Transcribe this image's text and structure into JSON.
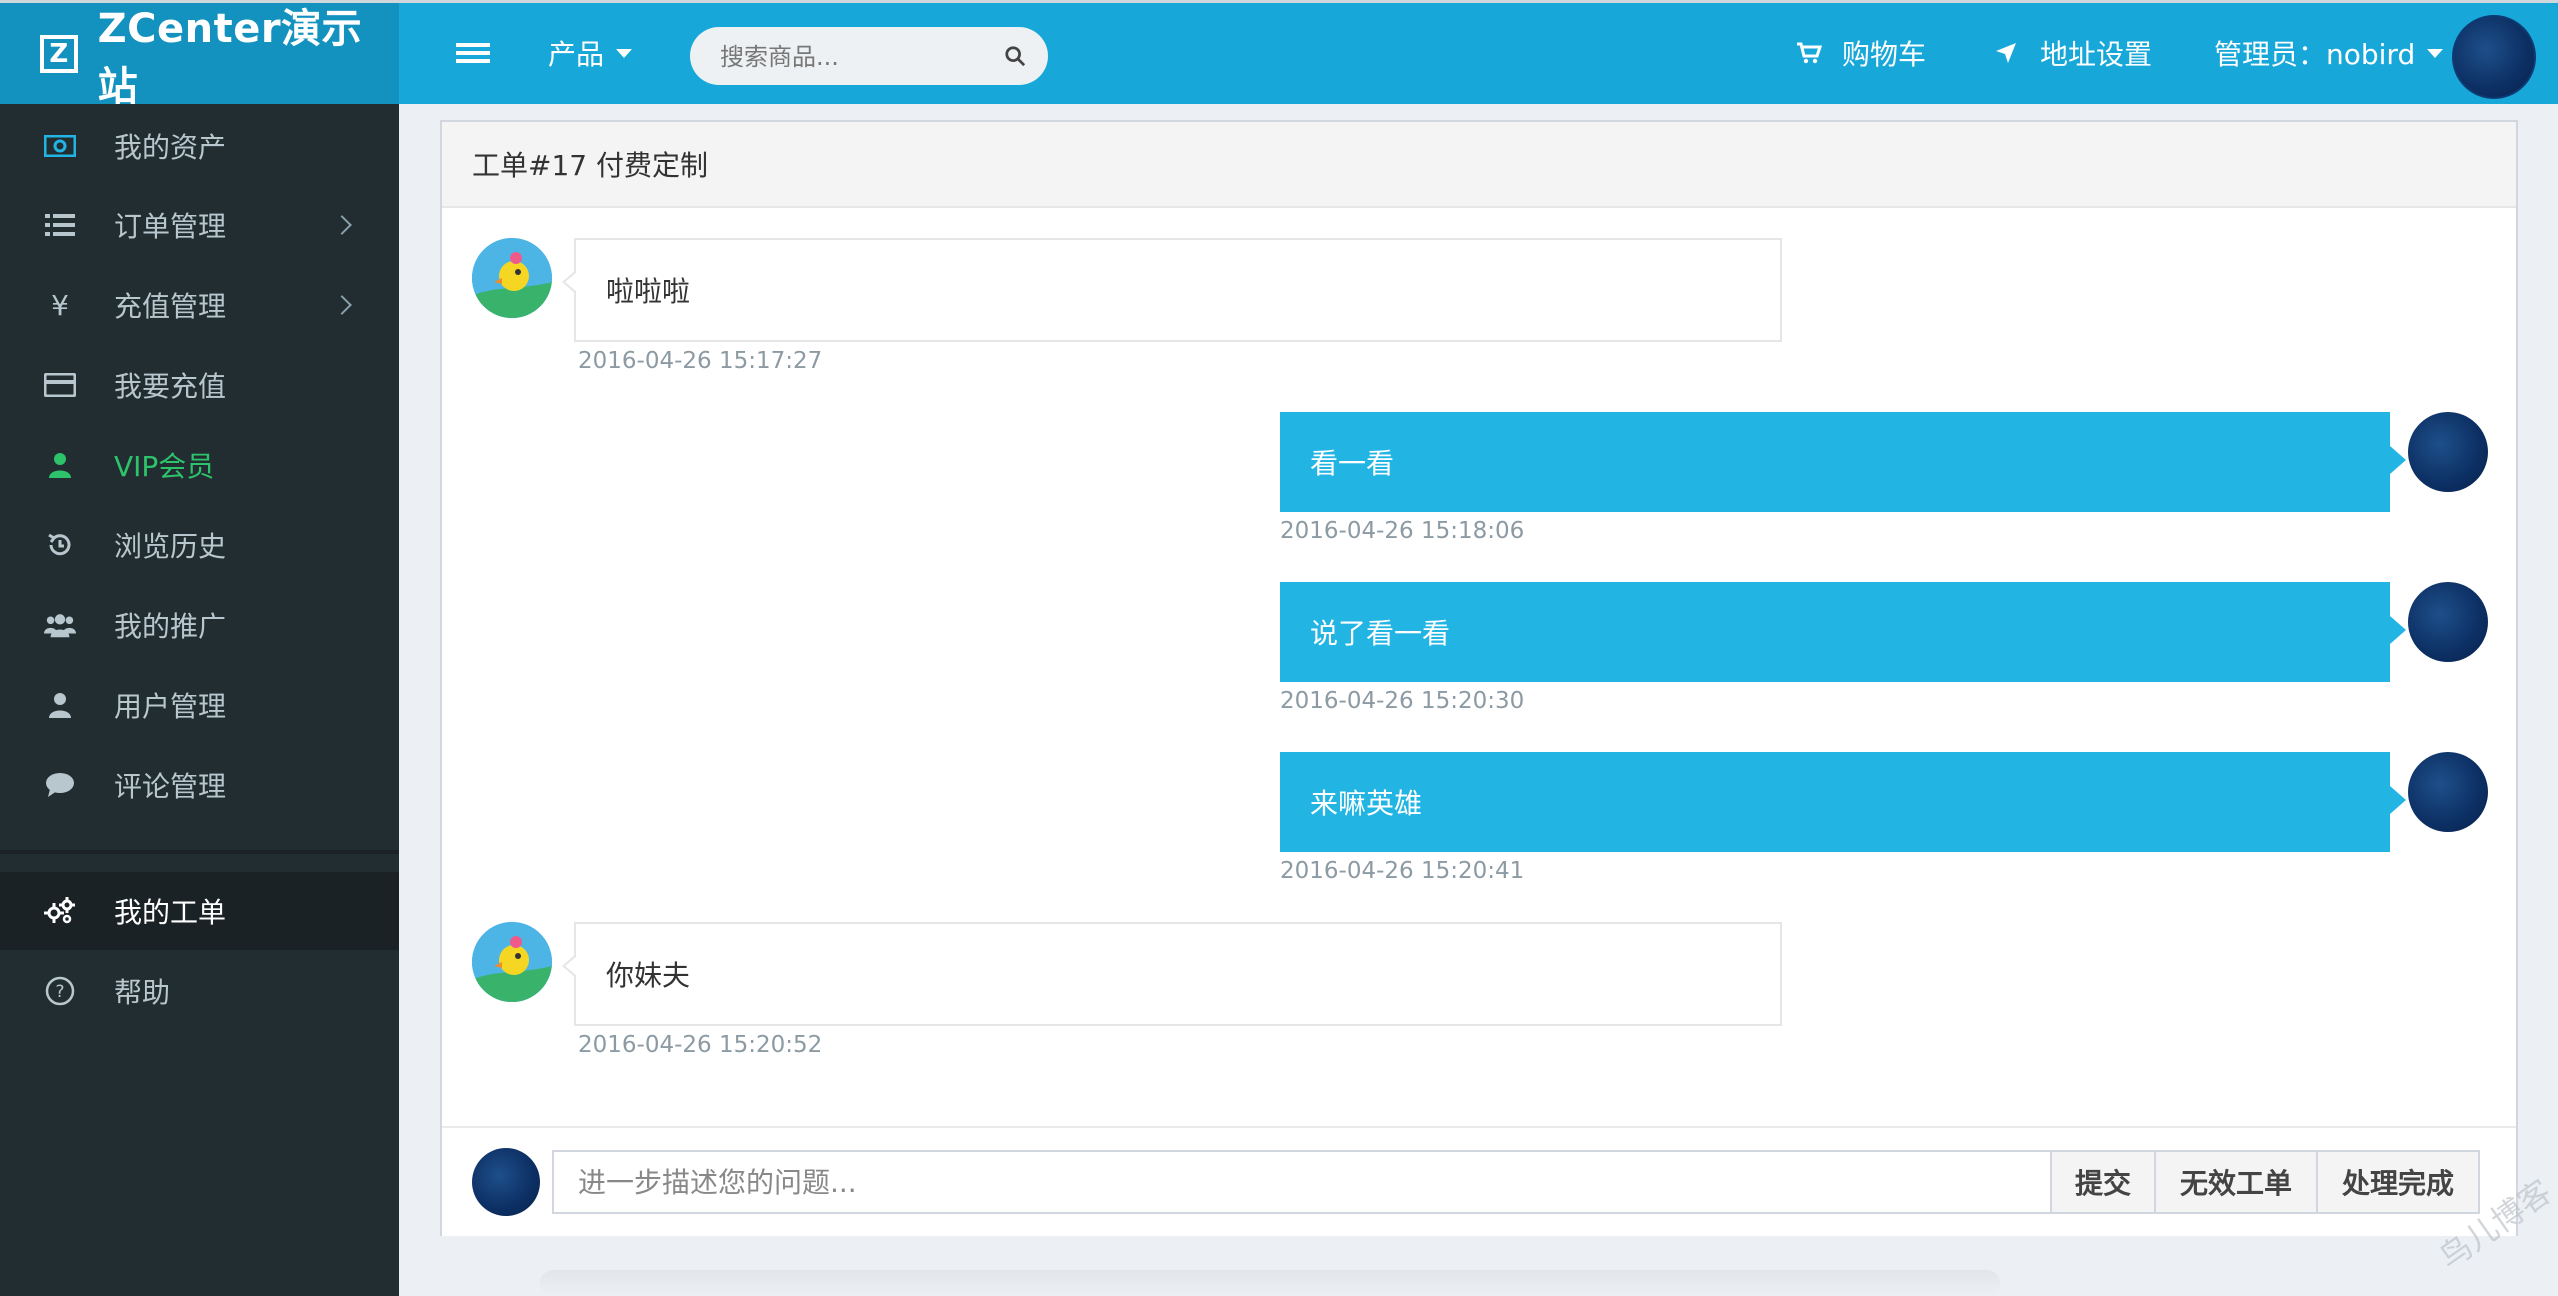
{
  "header": {
    "brand_title": "ZCenter演示站",
    "product_label": "产品",
    "search_placeholder": "搜索商品...",
    "cart_label": "购物车",
    "address_label": "地址设置",
    "admin_label": "管理员：nobird"
  },
  "sidebar": {
    "items": [
      {
        "label": "我的资产",
        "icon": "money-icon"
      },
      {
        "label": "订单管理",
        "icon": "list-icon"
      },
      {
        "label": "充值管理",
        "icon": "yen-icon"
      },
      {
        "label": "我要充值",
        "icon": "credit-card-icon"
      },
      {
        "label": "VIP会员",
        "icon": "user-icon"
      },
      {
        "label": "浏览历史",
        "icon": "history-icon"
      },
      {
        "label": "我的推广",
        "icon": "users-icon"
      },
      {
        "label": "用户管理",
        "icon": "user-icon"
      },
      {
        "label": "评论管理",
        "icon": "comment-icon"
      },
      {
        "label": "我的工单",
        "icon": "gears-icon"
      },
      {
        "label": "帮助",
        "icon": "question-circle-icon"
      }
    ]
  },
  "ticket": {
    "title": "工单#17 付费定制",
    "messages": [
      {
        "side": "left",
        "text": "啦啦啦",
        "time": "2016-04-26 15:17:27"
      },
      {
        "side": "right",
        "text": "看一看",
        "time": "2016-04-26 15:18:06"
      },
      {
        "side": "right",
        "text": "说了看一看",
        "time": "2016-04-26 15:20:30"
      },
      {
        "side": "right",
        "text": "来嘛英雄",
        "time": "2016-04-26 15:20:41"
      },
      {
        "side": "left",
        "text": "你妹夫",
        "time": "2016-04-26 15:20:52"
      }
    ],
    "reply_placeholder": "进一步描述您的问题...",
    "submit_label": "提交",
    "invalid_label": "无效工单",
    "done_label": "处理完成"
  },
  "watermark": "鸟儿博客",
  "colors": {
    "header_bg": "#17a7d9",
    "brand_bg": "#1492bf",
    "sidebar_bg": "#222d32",
    "vip_green": "#2dc36a",
    "bubble_blue": "#22b5e4"
  }
}
